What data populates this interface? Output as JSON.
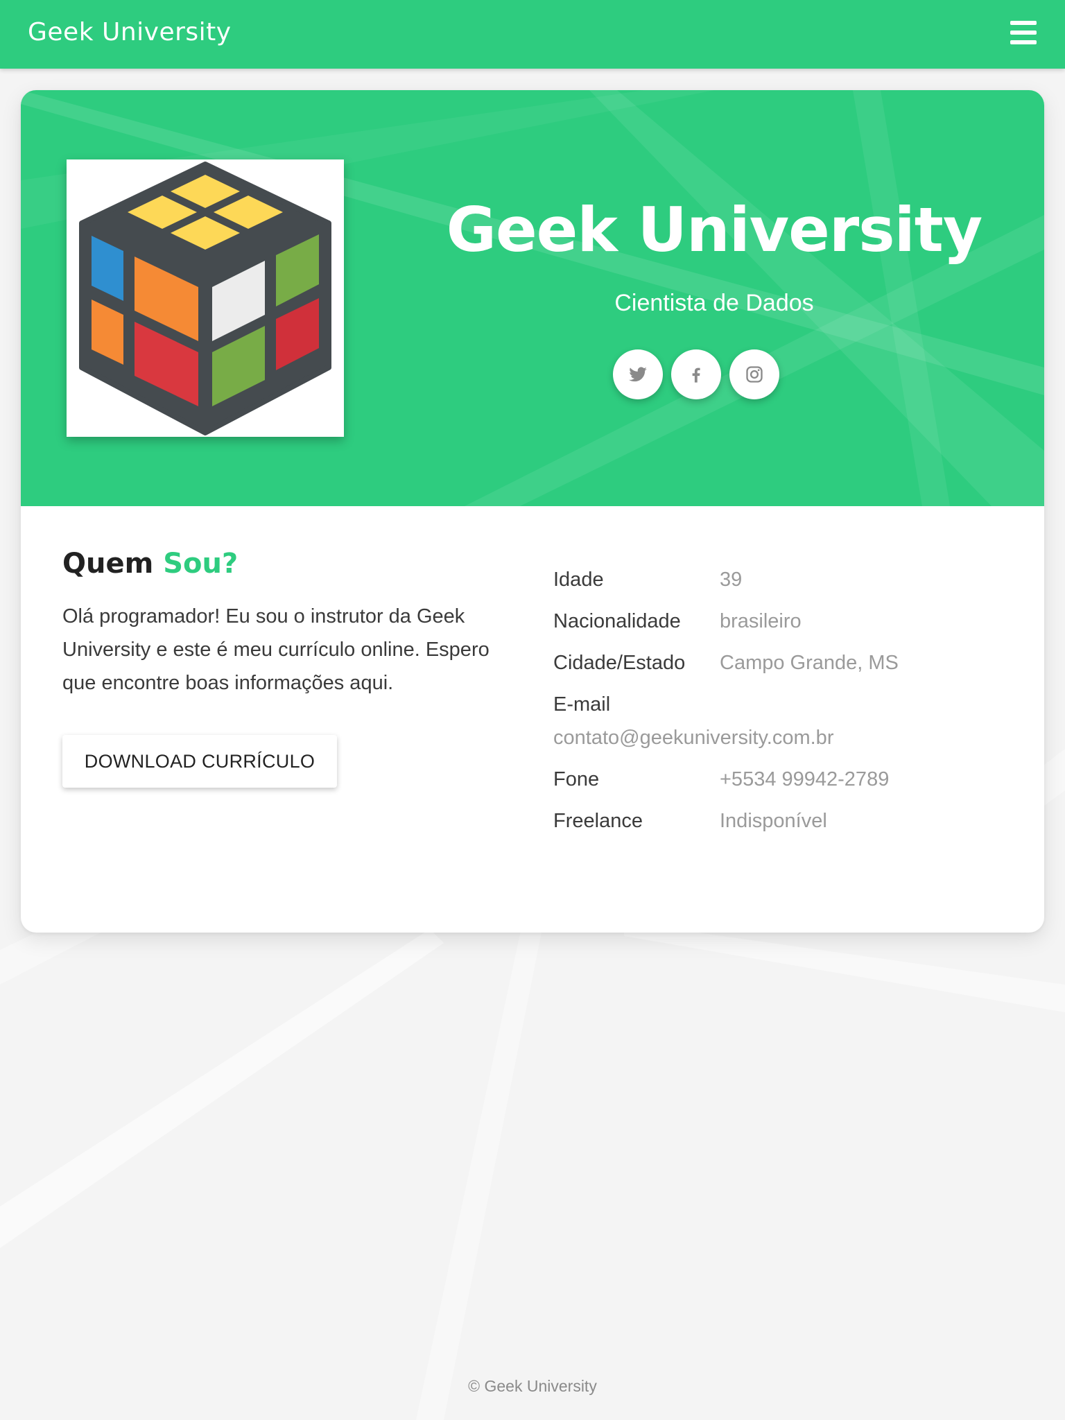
{
  "navbar": {
    "brand": "Geek University",
    "menu_icon": "hamburger-menu-icon"
  },
  "hero": {
    "title": "Geek University",
    "subtitle": "Cientista de Dados",
    "avatar_icon": "rubiks-cube-icon",
    "socials": [
      {
        "name": "twitter",
        "icon": "twitter-icon"
      },
      {
        "name": "facebook",
        "icon": "facebook-icon"
      },
      {
        "name": "instagram",
        "icon": "instagram-icon"
      }
    ]
  },
  "about": {
    "heading_main": "Quem",
    "heading_accent": "Sou?",
    "text": "Olá programador! Eu sou o instrutor da Geek University e este é meu currículo online. Espero que encontre boas informações aqui.",
    "download_label": "DOWNLOAD CURRÍCULO"
  },
  "info": {
    "rows": [
      {
        "label": "Idade",
        "value": "39"
      },
      {
        "label": "Nacionalidade",
        "value": "brasileiro"
      },
      {
        "label": "Cidade/Estado",
        "value": "Campo Grande, MS"
      },
      {
        "label": "E-mail",
        "value": "contato@geekuniversity.com.br"
      },
      {
        "label": "Fone",
        "value": "+5534 99942-2789"
      },
      {
        "label": "Freelance",
        "value": "Indisponível"
      }
    ]
  },
  "footer": {
    "text": "© Geek University"
  },
  "colors": {
    "accent": "#2ecc7f",
    "text_dark": "#222222",
    "text_muted": "#9a9a9a",
    "page_bg": "#f4f4f4"
  }
}
